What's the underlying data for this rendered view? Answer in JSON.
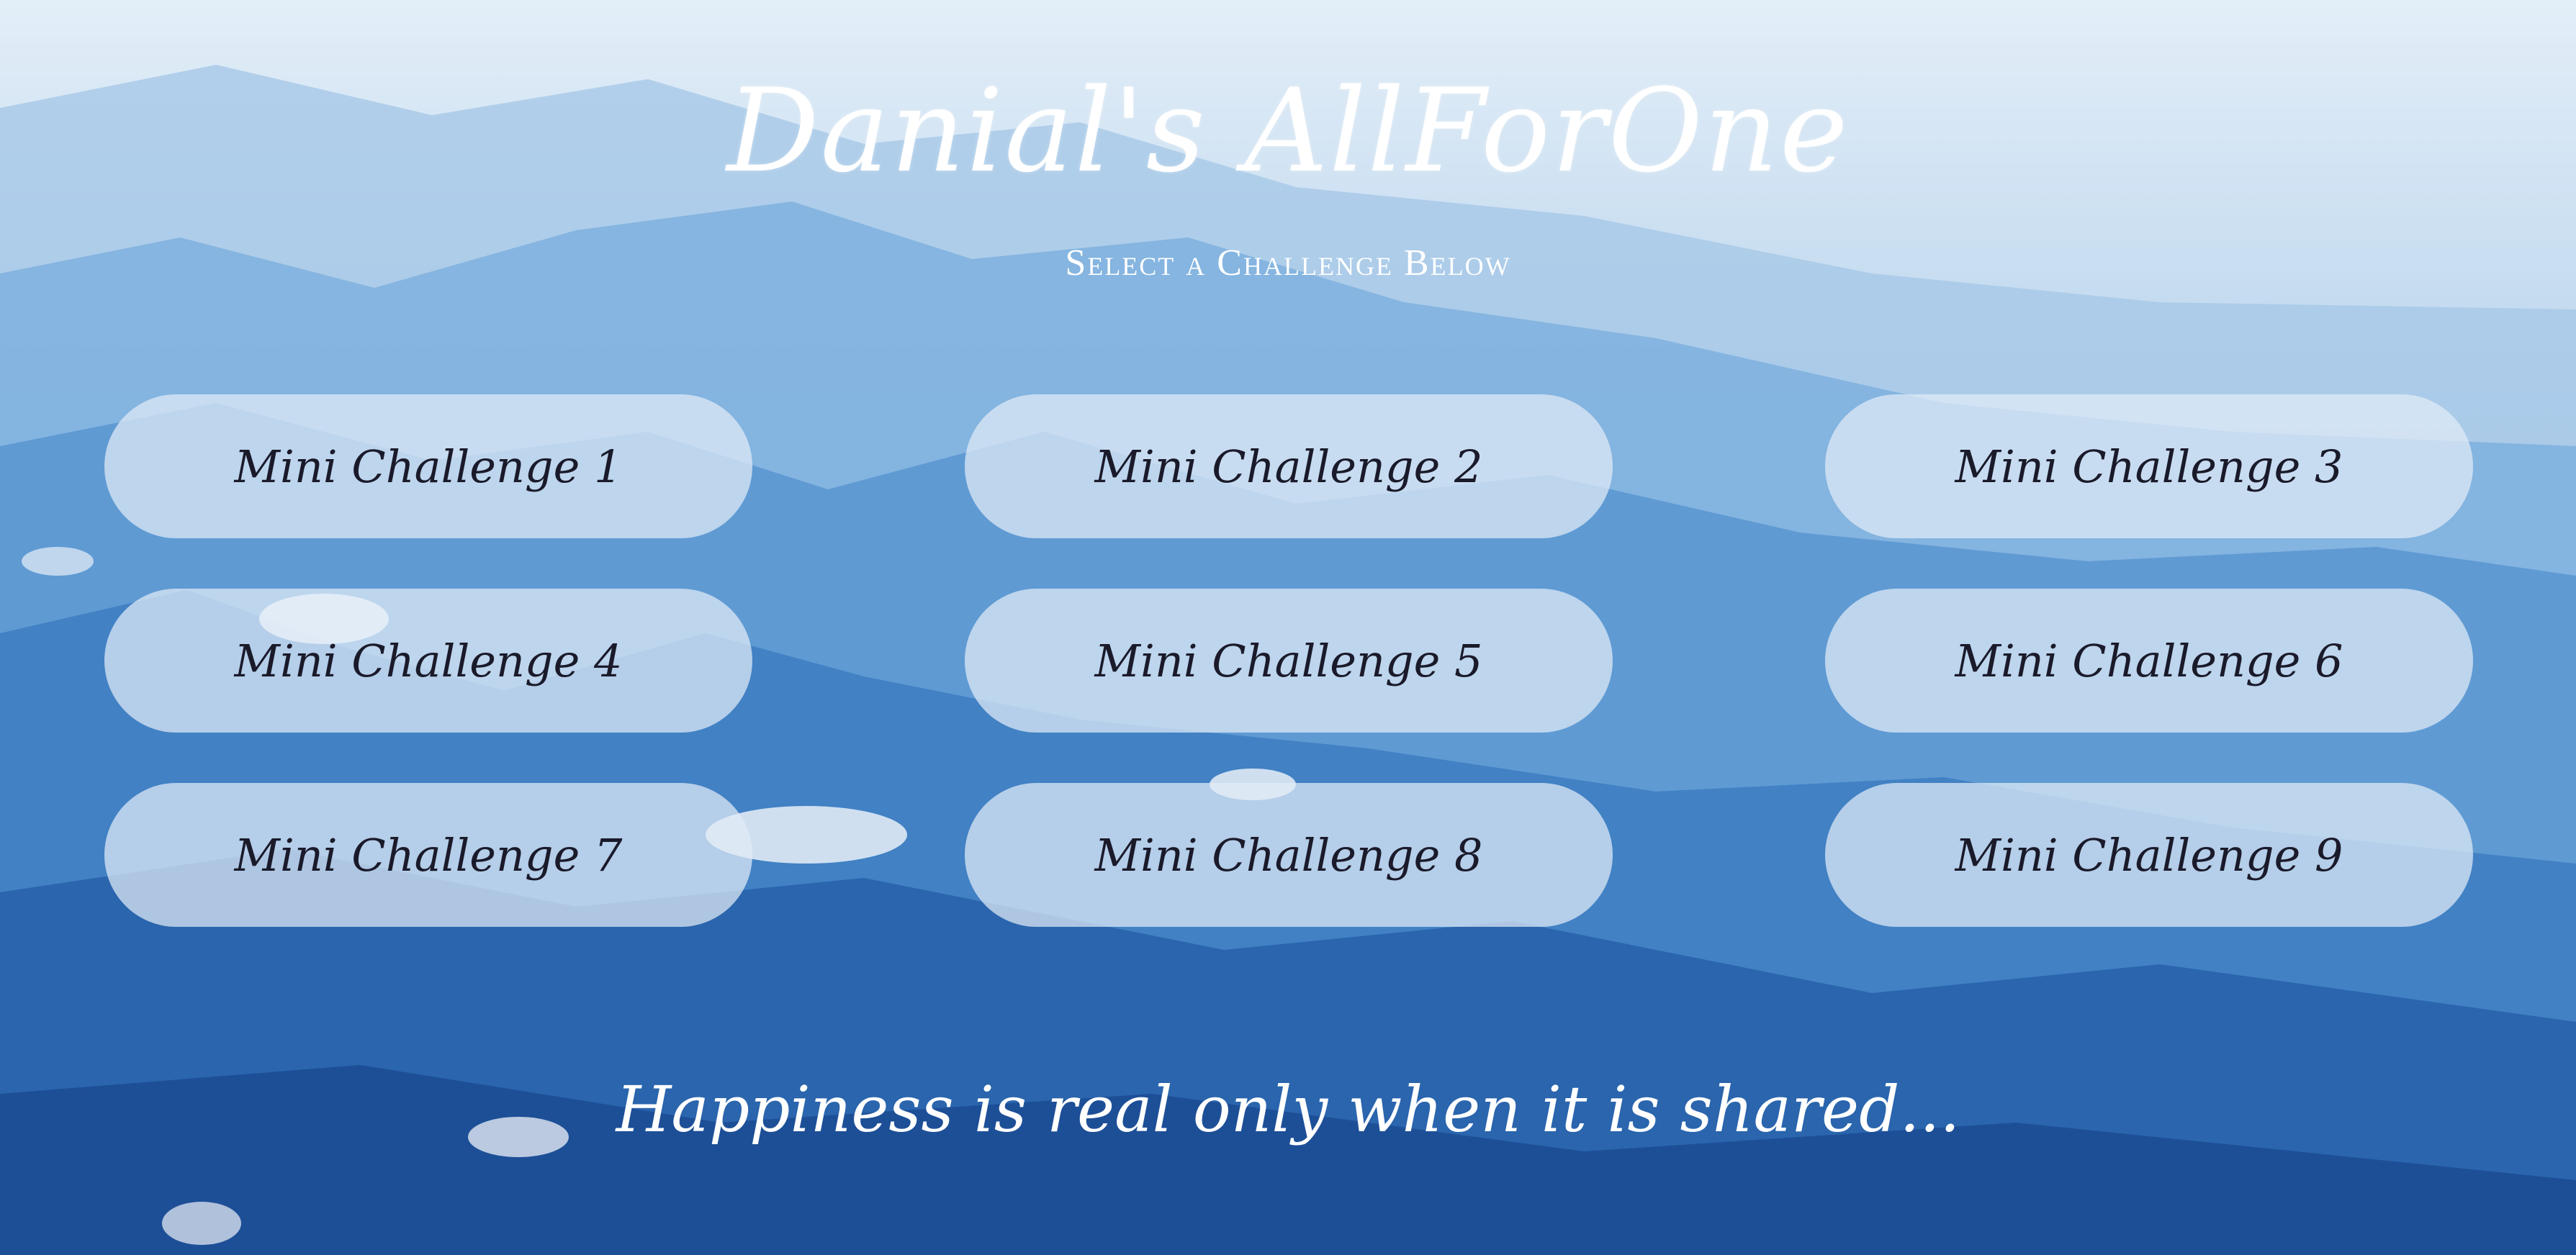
{
  "header": {
    "title": "Danial's AllForOne",
    "subtitle": "Select a Challenge Below"
  },
  "challenges": [
    {
      "label": "Mini Challenge 1"
    },
    {
      "label": "Mini Challenge 2"
    },
    {
      "label": "Mini Challenge 3"
    },
    {
      "label": "Mini Challenge 4"
    },
    {
      "label": "Mini Challenge 5"
    },
    {
      "label": "Mini Challenge 6"
    },
    {
      "label": "Mini Challenge 7"
    },
    {
      "label": "Mini Challenge 8"
    },
    {
      "label": "Mini Challenge 9"
    }
  ],
  "footer": {
    "quote": "Happiness is real only when it is shared..."
  },
  "background": {
    "description_colors": [
      "#cfe2f3",
      "#6fa7d8",
      "#2b6ab5"
    ]
  }
}
